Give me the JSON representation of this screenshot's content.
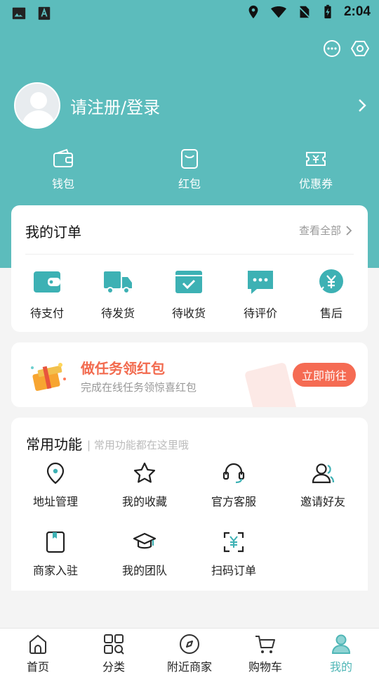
{
  "status_bar": {
    "time": "2:04"
  },
  "profile": {
    "login_label": "请注册/登录"
  },
  "wallet": [
    {
      "label": "钱包",
      "icon": "wallet-icon"
    },
    {
      "label": "红包",
      "icon": "red-packet-icon"
    },
    {
      "label": "优惠券",
      "icon": "coupon-icon"
    }
  ],
  "orders": {
    "title": "我的订单",
    "view_all": "查看全部",
    "items": [
      {
        "label": "待支付",
        "icon": "pending-payment-icon"
      },
      {
        "label": "待发货",
        "icon": "pending-shipment-icon"
      },
      {
        "label": "待收货",
        "icon": "pending-receipt-icon"
      },
      {
        "label": "待评价",
        "icon": "pending-review-icon"
      },
      {
        "label": "售后",
        "icon": "after-sales-icon"
      }
    ]
  },
  "task_banner": {
    "title": "做任务领红包",
    "subtitle": "完成在线任务领惊喜红包",
    "button": "立即前往"
  },
  "functions": {
    "title": "常用功能",
    "subtitle": "| 常用功能都在这里哦",
    "items": [
      {
        "label": "地址管理",
        "icon": "location-pin-icon"
      },
      {
        "label": "我的收藏",
        "icon": "star-icon"
      },
      {
        "label": "官方客服",
        "icon": "headset-icon"
      },
      {
        "label": "邀请好友",
        "icon": "invite-user-icon"
      },
      {
        "label": "商家入驻",
        "icon": "book-icon"
      },
      {
        "label": "我的团队",
        "icon": "graduation-cap-icon"
      },
      {
        "label": "扫码订单",
        "icon": "scan-icon"
      }
    ]
  },
  "tabbar": [
    {
      "label": "首页",
      "icon": "home-icon",
      "active": false
    },
    {
      "label": "分类",
      "icon": "category-icon",
      "active": false
    },
    {
      "label": "附近商家",
      "icon": "compass-icon",
      "active": false
    },
    {
      "label": "购物车",
      "icon": "cart-icon",
      "active": false
    },
    {
      "label": "我的",
      "icon": "user-icon",
      "active": true
    }
  ],
  "colors": {
    "teal": "#5cbcbc",
    "accent_orange": "#f56b53",
    "tab_active": "#4fb6b6"
  }
}
